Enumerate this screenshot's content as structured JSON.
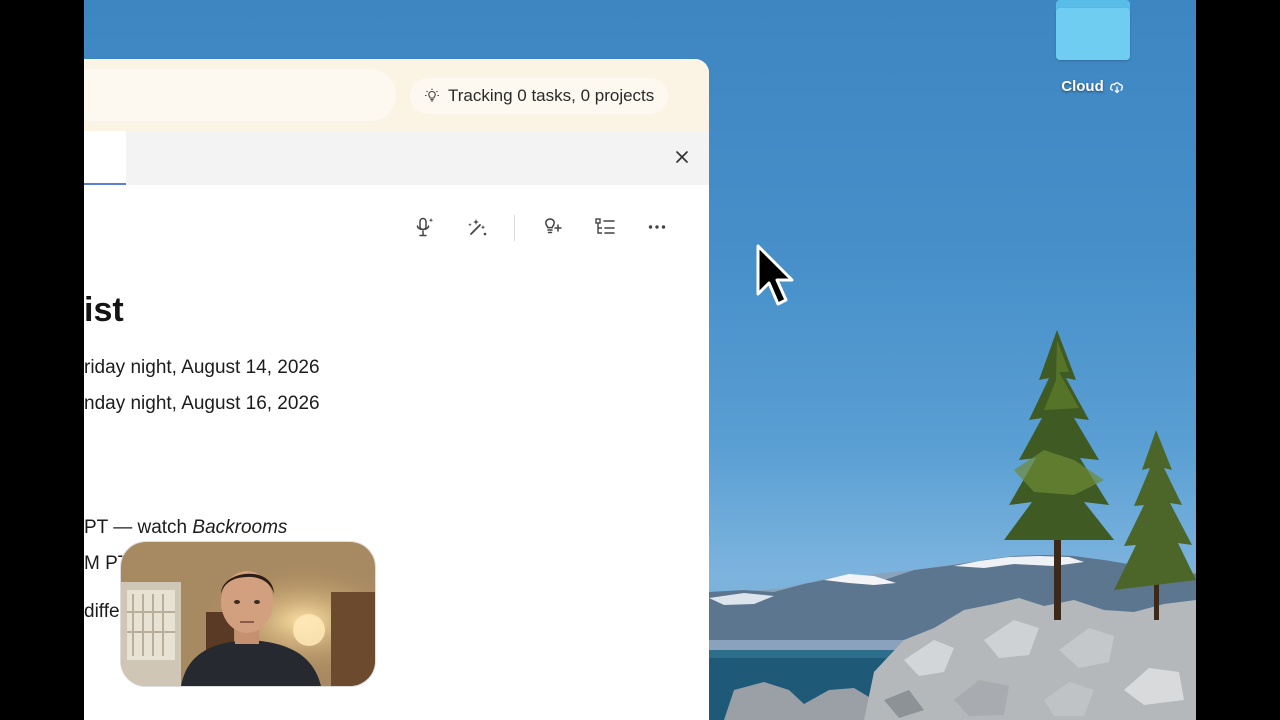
{
  "desktop": {
    "folder": {
      "label": "Cloud",
      "icon": "folder-icon",
      "badge_icon": "cloud-download-icon"
    }
  },
  "app": {
    "tracking": {
      "icon": "lightbulb-icon",
      "text": "Tracking 0 tasks, 0 projects"
    },
    "close_icon": "close-icon",
    "toolbar": [
      {
        "name": "voice-ai-button",
        "icon": "mic-sparkle-icon"
      },
      {
        "name": "ai-assist-button",
        "icon": "magic-wand-icon"
      },
      {
        "name": "idea-button",
        "icon": "lightbulb-plus-icon"
      },
      {
        "name": "outline-button",
        "icon": "outline-list-icon"
      },
      {
        "name": "more-button",
        "icon": "more-horizontal-icon"
      }
    ],
    "document": {
      "title": "ist",
      "lines": [
        "riday night, August 14, 2026",
        "nday night, August 16, 2026"
      ],
      "schedule_prefix": "PT — watch ",
      "schedule_italic": "Backrooms",
      "line_partial_1": "M PT",
      "line_partial_2": "diffe"
    }
  },
  "colors": {
    "window_top": "#fbf4e5",
    "tab_underline": "#5b7ed6",
    "desktop_sky": "#468fc9"
  }
}
